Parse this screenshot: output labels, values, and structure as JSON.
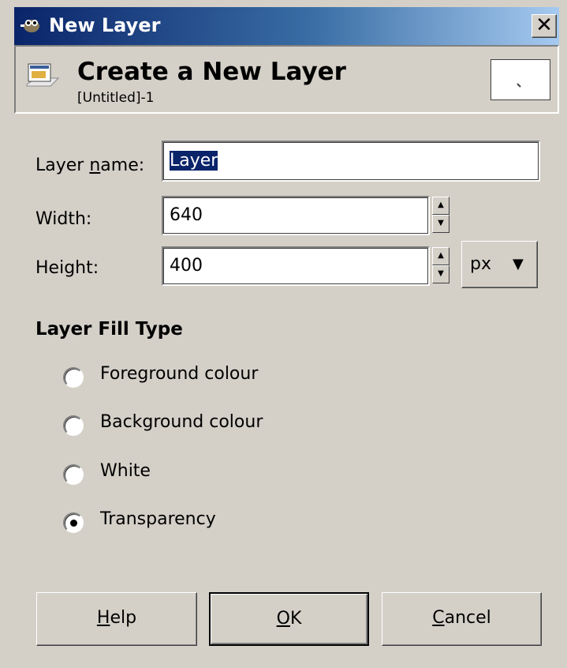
{
  "window": {
    "title": "New Layer",
    "close_glyph": "✕"
  },
  "header": {
    "title": "Create a New Layer",
    "subtitle": "[Untitled]-1"
  },
  "form": {
    "layer_name_label_pre": "Layer ",
    "layer_name_label_u": "n",
    "layer_name_label_post": "ame:",
    "layer_name_value": "Layer",
    "width_label": "Width:",
    "width_value": "640",
    "height_label": "Height:",
    "height_value": "400",
    "unit_value": "px",
    "unit_arrow": "▼"
  },
  "fill": {
    "heading": "Layer Fill Type",
    "options": [
      {
        "label": "Foreground colour",
        "selected": false
      },
      {
        "label": "Background colour",
        "selected": false
      },
      {
        "label": "White",
        "selected": false
      },
      {
        "label": "Transparency",
        "selected": true
      }
    ]
  },
  "buttons": {
    "help_u": "H",
    "help_rest": "elp",
    "ok_u": "O",
    "ok_rest": "K",
    "cancel_u": "C",
    "cancel_rest": "ancel"
  },
  "spinner": {
    "up": "▲",
    "down": "▼"
  },
  "icons": {
    "title_icon": "gimp-wilber-icon",
    "header_icon": "new-layer-icon",
    "preview": "layer-preview-thumbnail"
  }
}
